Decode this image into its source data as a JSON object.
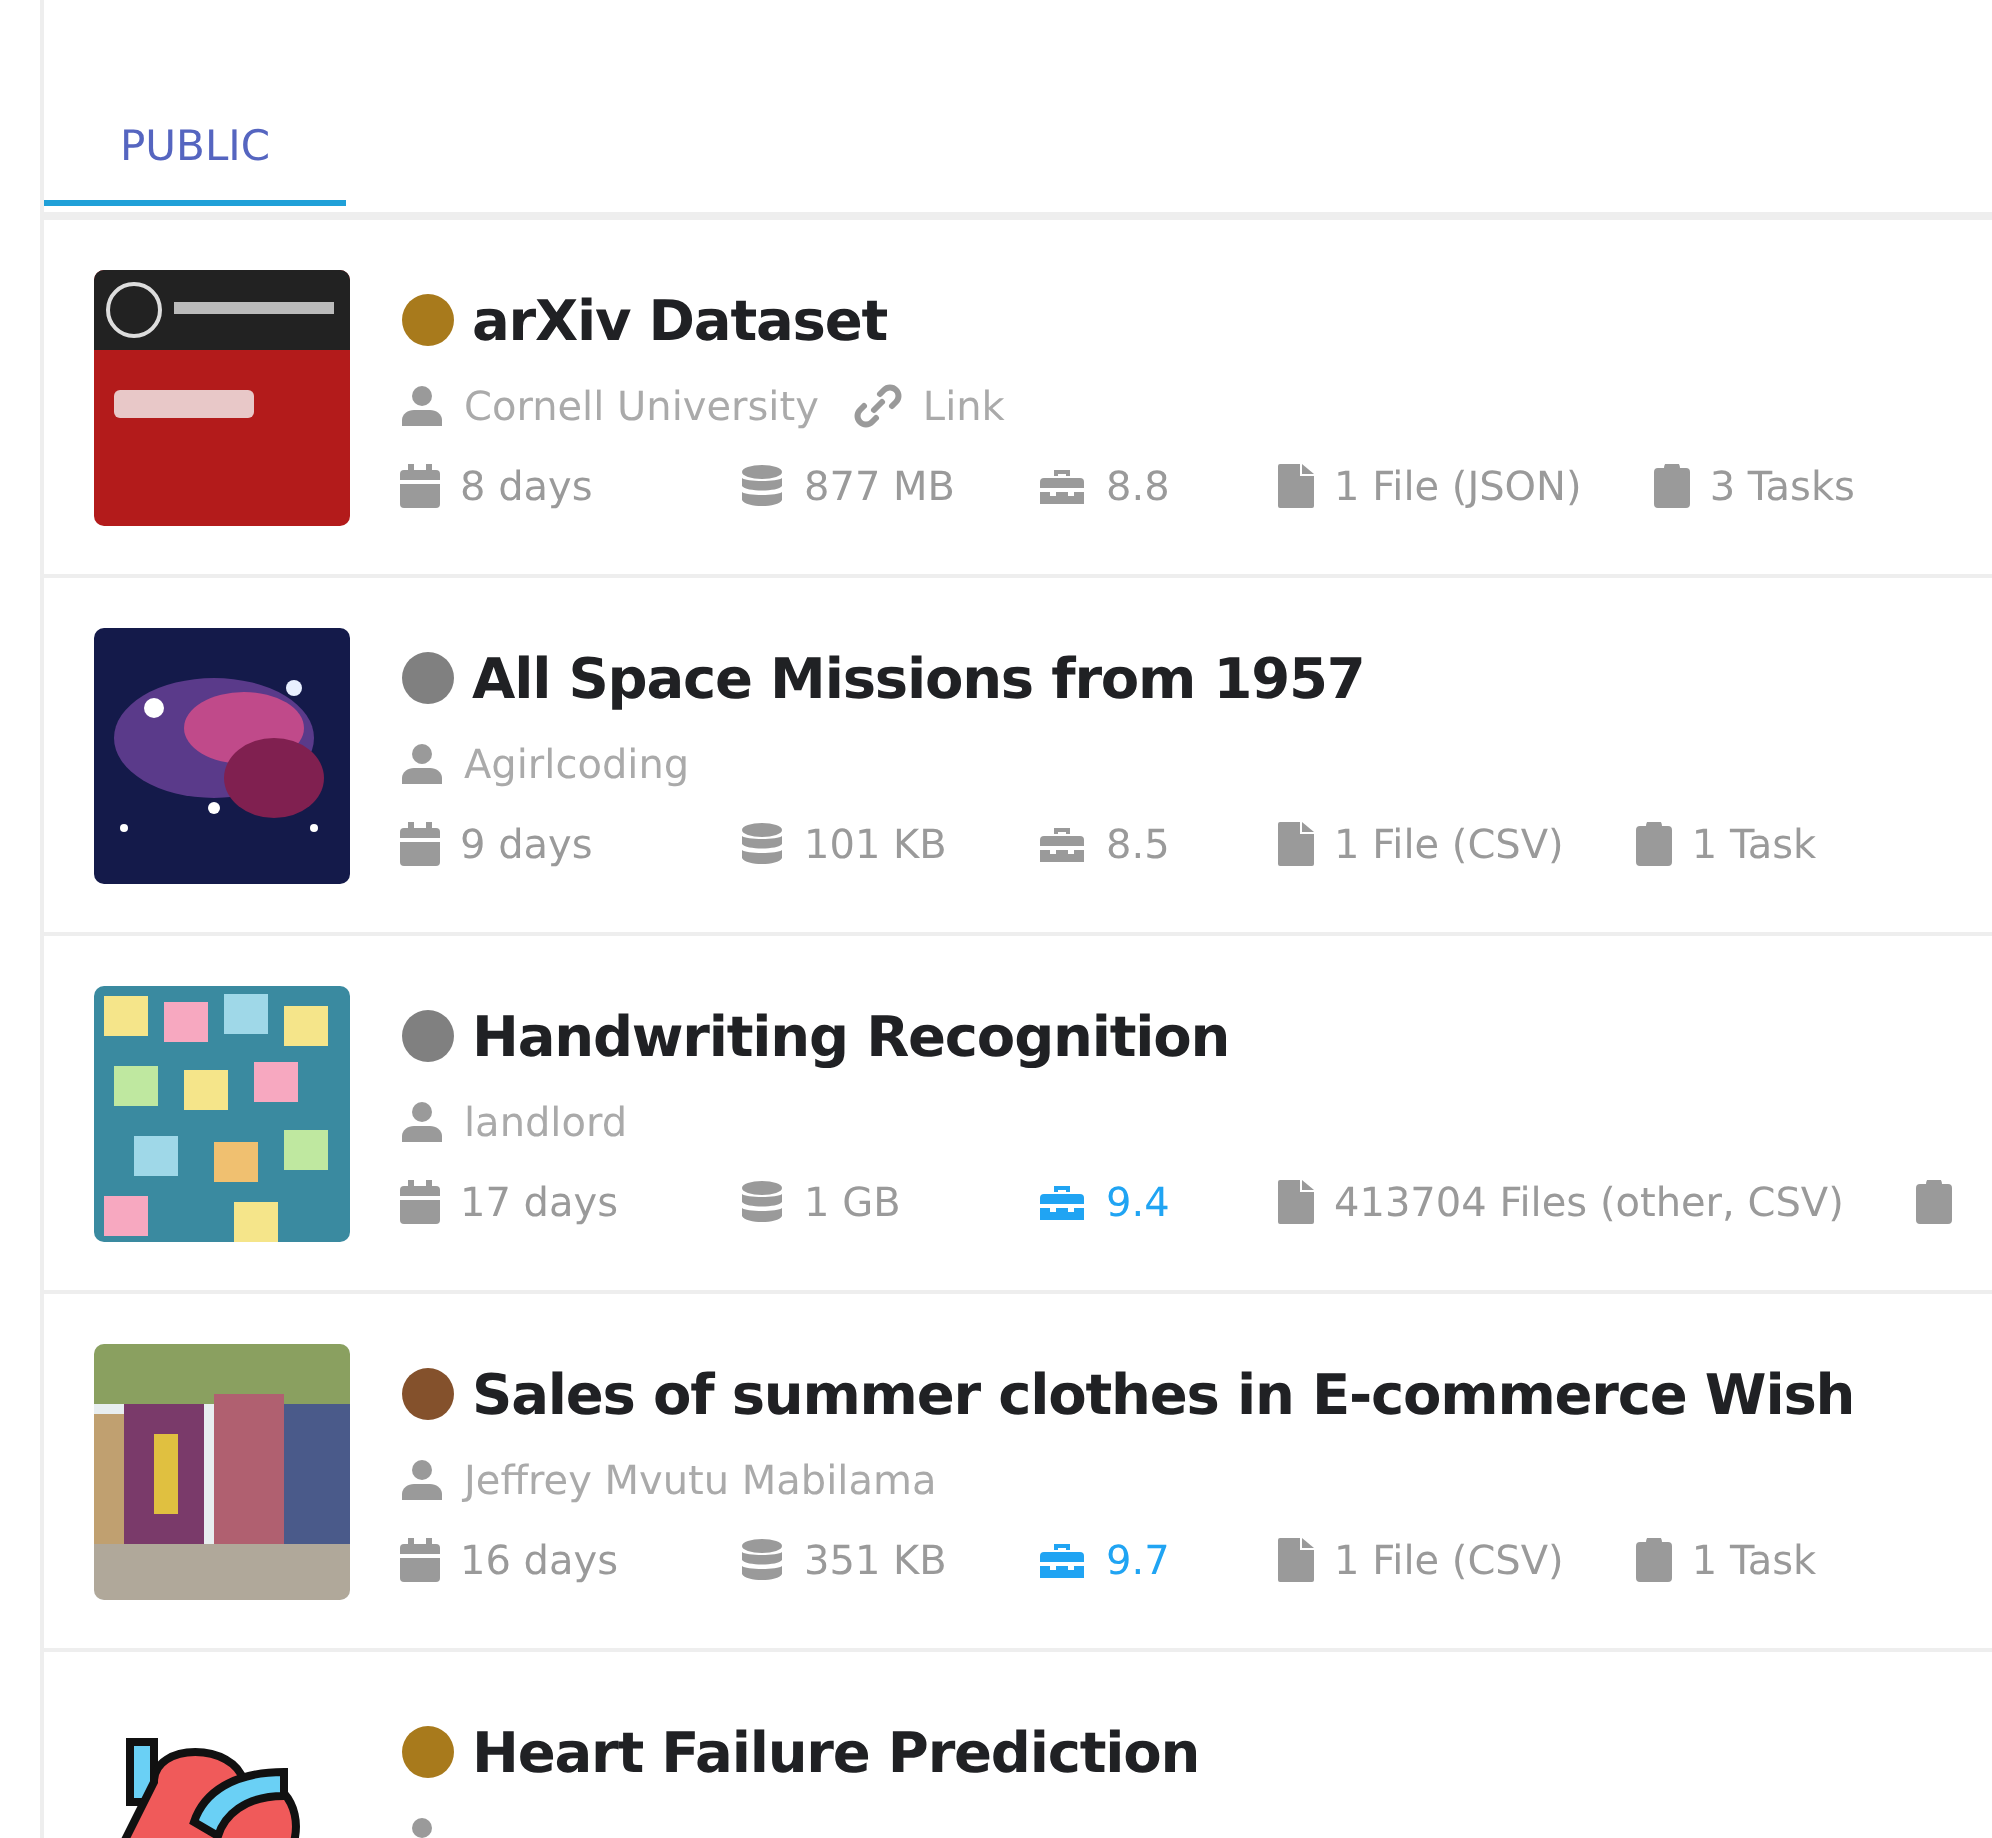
{
  "tabs": [
    {
      "label": "PUBLIC",
      "selected": true
    }
  ],
  "datasets": [
    {
      "title": "arXiv Dataset",
      "color": "#a87a1c",
      "author": "Cornell University",
      "link": "Link",
      "meta": [
        {
          "kind": "date",
          "text": "8 days"
        },
        {
          "kind": "size",
          "text": "877 MB"
        },
        {
          "kind": "usability",
          "text": "8.8",
          "highlighted": false
        },
        {
          "kind": "files",
          "text": "1 File (JSON)"
        },
        {
          "kind": "tasks",
          "text": "3 Tasks"
        }
      ]
    },
    {
      "title": "All Space Missions from 1957",
      "color": "#808080",
      "author": "Agirlcoding",
      "meta": [
        {
          "kind": "date",
          "text": "9 days"
        },
        {
          "kind": "size",
          "text": "101 KB"
        },
        {
          "kind": "usability",
          "text": "8.5",
          "highlighted": false
        },
        {
          "kind": "files",
          "text": "1 File (CSV)"
        },
        {
          "kind": "tasks",
          "text": "1 Task"
        }
      ]
    },
    {
      "title": "Handwriting Recognition",
      "color": "#808080",
      "author": "landlord",
      "meta": [
        {
          "kind": "date",
          "text": "17 days"
        },
        {
          "kind": "size",
          "text": "1 GB"
        },
        {
          "kind": "usability",
          "text": "9.4",
          "highlighted": true
        },
        {
          "kind": "files",
          "text": "413704 Files (other, CSV)"
        },
        {
          "kind": "tasks"
        }
      ]
    },
    {
      "title": "Sales of summer clothes in E-commerce Wish",
      "color": "#84512c",
      "author": "Jeffrey Mvutu Mabilama",
      "meta": [
        {
          "kind": "date",
          "text": "16 days"
        },
        {
          "kind": "size",
          "text": "351 KB"
        },
        {
          "kind": "usability",
          "text": "9.7",
          "highlighted": true
        },
        {
          "kind": "files",
          "text": "1 File (CSV)"
        },
        {
          "kind": "tasks",
          "text": "1 Task"
        }
      ]
    },
    {
      "title": "Heart Failure Prediction",
      "color": "#a87a1c"
    }
  ]
}
